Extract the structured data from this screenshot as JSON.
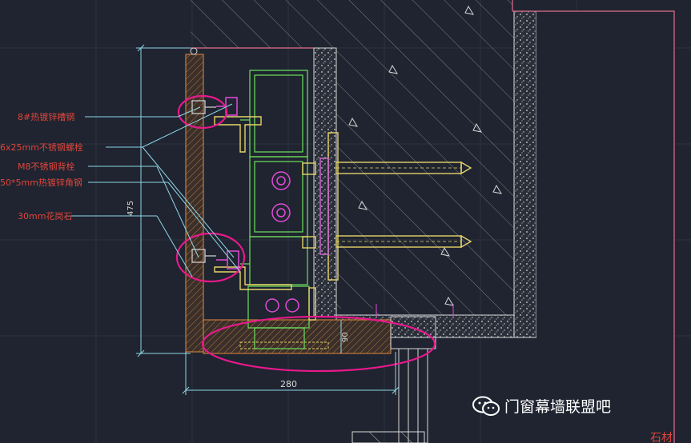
{
  "labels": [
    "8#热镀锌槽钢",
    "6x25mm不锈钢螺栓",
    "M8不锈钢背栓",
    "50*5mm热镀锌角钢",
    "30mm花岗石"
  ],
  "dimensions": {
    "height": "475",
    "width": "280",
    "small": "90"
  },
  "watermark": {
    "text": "门窗幕墙联盟吧",
    "icon": "wechat-icon"
  },
  "corner_text": "石材"
}
